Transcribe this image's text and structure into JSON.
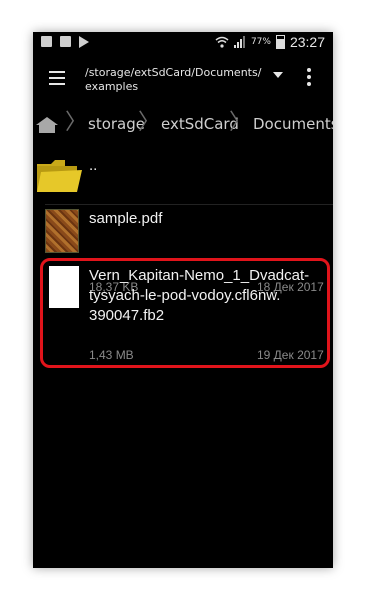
{
  "status_bar": {
    "battery": "77%",
    "time": "23:27"
  },
  "toolbar": {
    "path_line1": "/storage/extSdCard/Documents/",
    "path_line2": "examples",
    "icons": [
      "menu-icon",
      "dropdown-arrow-icon",
      "overflow-menu-icon"
    ]
  },
  "breadcrumb": {
    "items": [
      "storage",
      "extSdCard",
      "Documents"
    ]
  },
  "files": [
    {
      "name": "..",
      "size": "",
      "date": "",
      "icon": "folder-icon"
    },
    {
      "name": "sample.pdf",
      "size": "18,37 KB",
      "date": "18 Дек 2017",
      "icon": "pdf-thumbnail-icon"
    },
    {
      "name": "Vern_Kapitan-Nemo_1_Dvadcat-tysyach-le-pod-vodoy.cfl6nw.390047.fb2",
      "name_lines": [
        "Vern_Kapitan-Nemo_1_Dvadcat-",
        "tysyach-le-pod-vodoy.cfl6nw.",
        "390047.fb2"
      ],
      "size": "1,43 MB",
      "date": "19 Дек 2017",
      "icon": "document-icon"
    }
  ],
  "colors": {
    "background": "#000000",
    "highlight": "#e1141b",
    "folder": "#e6c829"
  }
}
